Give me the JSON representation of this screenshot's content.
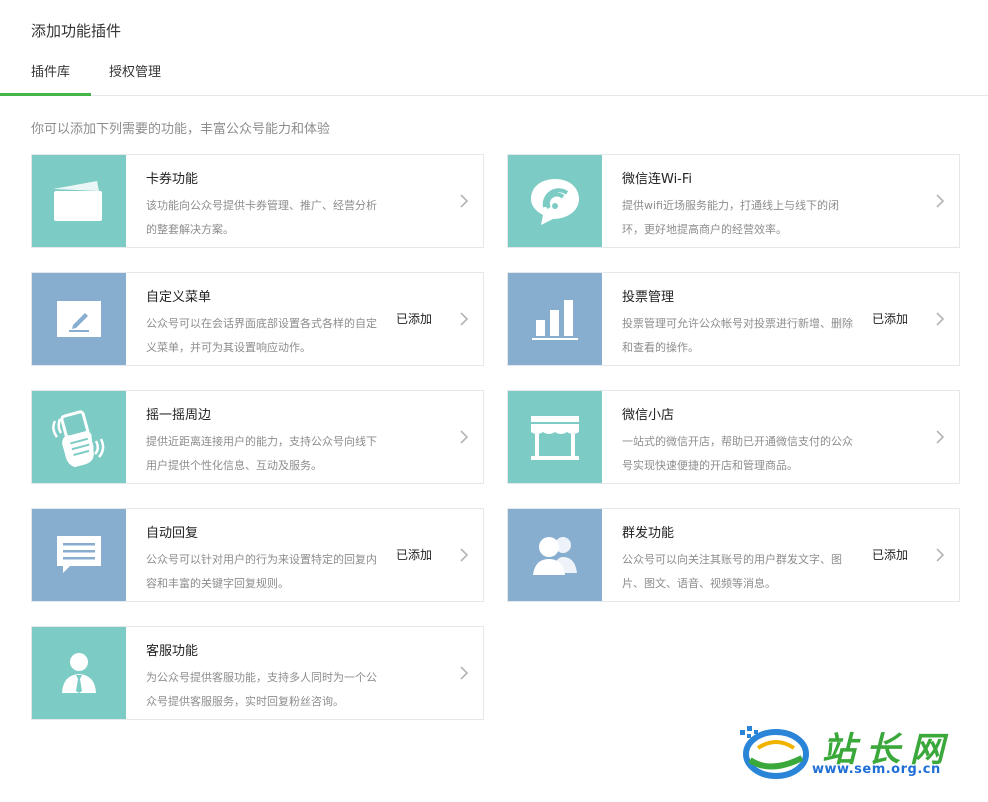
{
  "page_title": "添加功能插件",
  "tabs": [
    {
      "label": "插件库",
      "active": true
    },
    {
      "label": "授权管理",
      "active": false
    }
  ],
  "intro": "你可以添加下列需要的功能，丰富公众号能力和体验",
  "colors": {
    "accent": "#44b549",
    "teal": "#7ccbc4",
    "blue": "#87aecf"
  },
  "cards": [
    {
      "name": "卡券功能",
      "desc": "该功能向公众号提供卡券管理、推广、经营分析的整套解决方案。",
      "status": "",
      "icon": "card-icon",
      "color": "teal"
    },
    {
      "name": "微信连Wi-Fi",
      "desc": "提供wifi近场服务能力，打通线上与线下的闭环，更好地提高商户的经营效率。",
      "status": "",
      "icon": "wifi-icon",
      "color": "teal"
    },
    {
      "name": "自定义菜单",
      "desc": "公众号可以在会话界面底部设置各式各样的自定义菜单，并可为其设置响应动作。",
      "status": "已添加",
      "icon": "edit-icon",
      "color": "blue"
    },
    {
      "name": "投票管理",
      "desc": "投票管理可允许公众帐号对投票进行新增、删除和查看的操作。",
      "status": "已添加",
      "icon": "bar-chart-icon",
      "color": "blue"
    },
    {
      "name": "摇一摇周边",
      "desc": "提供近距离连接用户的能力，支持公众号向线下用户提供个性化信息、互动及服务。",
      "status": "",
      "icon": "shake-phone-icon",
      "color": "teal"
    },
    {
      "name": "微信小店",
      "desc": "一站式的微信开店，帮助已开通微信支付的公众号实现快速便捷的开店和管理商品。",
      "status": "",
      "icon": "shop-icon",
      "color": "teal"
    },
    {
      "name": "自动回复",
      "desc": "公众号可以针对用户的行为来设置特定的回复内容和丰富的关键字回复规则。",
      "status": "已添加",
      "icon": "message-icon",
      "color": "blue"
    },
    {
      "name": "群发功能",
      "desc": "公众号可以向关注其账号的用户群发文字、图片、图文、语音、视频等消息。",
      "status": "已添加",
      "icon": "users-icon",
      "color": "blue"
    },
    {
      "name": "客服功能",
      "desc": "为公众号提供客服功能，支持多人同时为一个公众号提供客服服务，实时回复粉丝咨询。",
      "status": "",
      "icon": "agent-icon",
      "color": "teal"
    }
  ],
  "watermark": {
    "text": "站长网",
    "url": "www.sem.org.cn"
  }
}
